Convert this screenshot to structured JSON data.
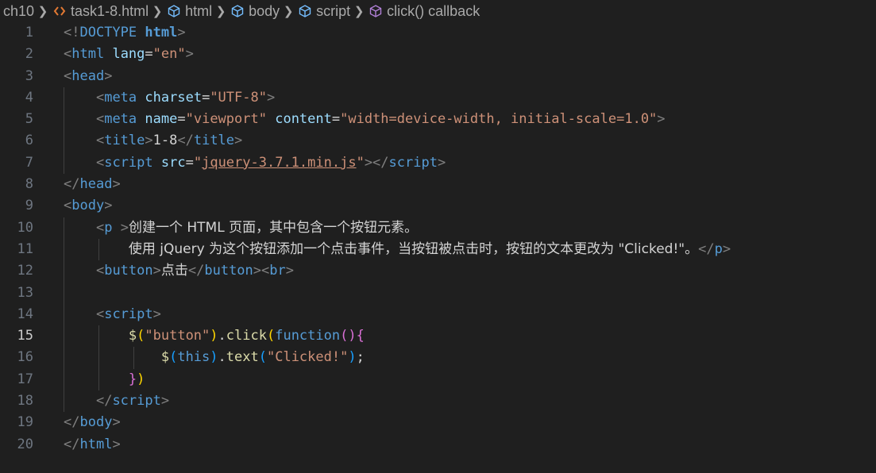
{
  "breadcrumb": {
    "folder": "ch10",
    "file": "task1-8.html",
    "html": "html",
    "body": "body",
    "script": "script",
    "callback": "click() callback"
  },
  "active_line": 15,
  "lines": [
    {
      "n": "1",
      "tokens": [
        [
          "punct",
          "<!"
        ],
        [
          "tag",
          "DOCTYPE"
        ],
        [
          "text",
          " "
        ],
        [
          "bold",
          "html"
        ],
        [
          "punct",
          ">"
        ]
      ]
    },
    {
      "n": "2",
      "tokens": [
        [
          "punct",
          "<"
        ],
        [
          "tag",
          "html"
        ],
        [
          "text",
          " "
        ],
        [
          "attr",
          "lang"
        ],
        [
          "text",
          "="
        ],
        [
          "str",
          "\"en\""
        ],
        [
          "punct",
          ">"
        ]
      ]
    },
    {
      "n": "3",
      "tokens": [
        [
          "punct",
          "<"
        ],
        [
          "tag",
          "head"
        ],
        [
          "punct",
          ">"
        ]
      ]
    },
    {
      "n": "4",
      "tokens": [
        [
          "text",
          "    "
        ],
        [
          "punct",
          "<"
        ],
        [
          "tag",
          "meta"
        ],
        [
          "text",
          " "
        ],
        [
          "attr",
          "charset"
        ],
        [
          "text",
          "="
        ],
        [
          "str",
          "\"UTF-8\""
        ],
        [
          "punct",
          ">"
        ]
      ]
    },
    {
      "n": "5",
      "tokens": [
        [
          "text",
          "    "
        ],
        [
          "punct",
          "<"
        ],
        [
          "tag",
          "meta"
        ],
        [
          "text",
          " "
        ],
        [
          "attr",
          "name"
        ],
        [
          "text",
          "="
        ],
        [
          "str",
          "\"viewport\""
        ],
        [
          "text",
          " "
        ],
        [
          "attr",
          "content"
        ],
        [
          "text",
          "="
        ],
        [
          "str",
          "\"width=device-width, initial-scale=1.0\""
        ],
        [
          "punct",
          ">"
        ]
      ]
    },
    {
      "n": "6",
      "tokens": [
        [
          "text",
          "    "
        ],
        [
          "punct",
          "<"
        ],
        [
          "tag",
          "title"
        ],
        [
          "punct",
          ">"
        ],
        [
          "text",
          "1-8"
        ],
        [
          "punct",
          "</"
        ],
        [
          "tag",
          "title"
        ],
        [
          "punct",
          ">"
        ]
      ]
    },
    {
      "n": "7",
      "tokens": [
        [
          "text",
          "    "
        ],
        [
          "punct",
          "<"
        ],
        [
          "tag",
          "script"
        ],
        [
          "text",
          " "
        ],
        [
          "attr",
          "src"
        ],
        [
          "text",
          "="
        ],
        [
          "str",
          "\""
        ],
        [
          "strul",
          "jquery-3.7.1.min.js"
        ],
        [
          "str",
          "\""
        ],
        [
          "punct",
          "></"
        ],
        [
          "tag",
          "script"
        ],
        [
          "punct",
          ">"
        ]
      ]
    },
    {
      "n": "8",
      "tokens": [
        [
          "punct",
          "</"
        ],
        [
          "tag",
          "head"
        ],
        [
          "punct",
          ">"
        ]
      ]
    },
    {
      "n": "9",
      "tokens": [
        [
          "punct",
          "<"
        ],
        [
          "tag",
          "body"
        ],
        [
          "punct",
          ">"
        ]
      ]
    },
    {
      "n": "10",
      "tokens": [
        [
          "text",
          "    "
        ],
        [
          "punct",
          "<"
        ],
        [
          "tag",
          "p"
        ],
        [
          "text",
          " "
        ],
        [
          "punct",
          ">"
        ],
        [
          "cjk",
          "创建一个 HTML 页面，其中包含一个按钮元素。"
        ]
      ]
    },
    {
      "n": "11",
      "tokens": [
        [
          "text",
          "        "
        ],
        [
          "cjk",
          "使用 jQuery 为这个按钮添加一个点击事件，当按钮被点击时，按钮的文本更改为 \"Clicked!\"。"
        ],
        [
          "punct",
          "</"
        ],
        [
          "tag",
          "p"
        ],
        [
          "punct",
          ">"
        ]
      ]
    },
    {
      "n": "12",
      "tokens": [
        [
          "text",
          "    "
        ],
        [
          "punct",
          "<"
        ],
        [
          "tag",
          "button"
        ],
        [
          "punct",
          ">"
        ],
        [
          "cjk",
          "点击"
        ],
        [
          "punct",
          "</"
        ],
        [
          "tag",
          "button"
        ],
        [
          "punct",
          "><"
        ],
        [
          "tag",
          "br"
        ],
        [
          "punct",
          ">"
        ]
      ]
    },
    {
      "n": "13",
      "tokens": []
    },
    {
      "n": "14",
      "tokens": [
        [
          "text",
          "    "
        ],
        [
          "punct",
          "<"
        ],
        [
          "tag",
          "script"
        ],
        [
          "punct",
          ">"
        ]
      ]
    },
    {
      "n": "15",
      "tokens": [
        [
          "text",
          "        "
        ],
        [
          "fn",
          "$"
        ],
        [
          "br1",
          "("
        ],
        [
          "str",
          "\"button\""
        ],
        [
          "br1",
          ")"
        ],
        [
          "text",
          "."
        ],
        [
          "fn",
          "click"
        ],
        [
          "br1",
          "("
        ],
        [
          "kw",
          "function"
        ],
        [
          "br2",
          "("
        ],
        [
          "br2",
          ")"
        ],
        [
          "br2",
          "{"
        ]
      ]
    },
    {
      "n": "16",
      "tokens": [
        [
          "text",
          "            "
        ],
        [
          "fn",
          "$"
        ],
        [
          "br3",
          "("
        ],
        [
          "kw",
          "this"
        ],
        [
          "br3",
          ")"
        ],
        [
          "text",
          "."
        ],
        [
          "fn",
          "text"
        ],
        [
          "br3",
          "("
        ],
        [
          "str",
          "\"Clicked!\""
        ],
        [
          "br3",
          ")"
        ],
        [
          "text",
          ";"
        ]
      ]
    },
    {
      "n": "17",
      "tokens": [
        [
          "text",
          "        "
        ],
        [
          "br2",
          "}"
        ],
        [
          "br1",
          ")"
        ]
      ]
    },
    {
      "n": "18",
      "tokens": [
        [
          "text",
          "    "
        ],
        [
          "punct",
          "</"
        ],
        [
          "tag",
          "script"
        ],
        [
          "punct",
          ">"
        ]
      ]
    },
    {
      "n": "19",
      "tokens": [
        [
          "punct",
          "</"
        ],
        [
          "tag",
          "body"
        ],
        [
          "punct",
          ">"
        ]
      ]
    },
    {
      "n": "20",
      "tokens": [
        [
          "punct",
          "</"
        ],
        [
          "tag",
          "html"
        ],
        [
          "punct",
          ">"
        ]
      ]
    }
  ]
}
